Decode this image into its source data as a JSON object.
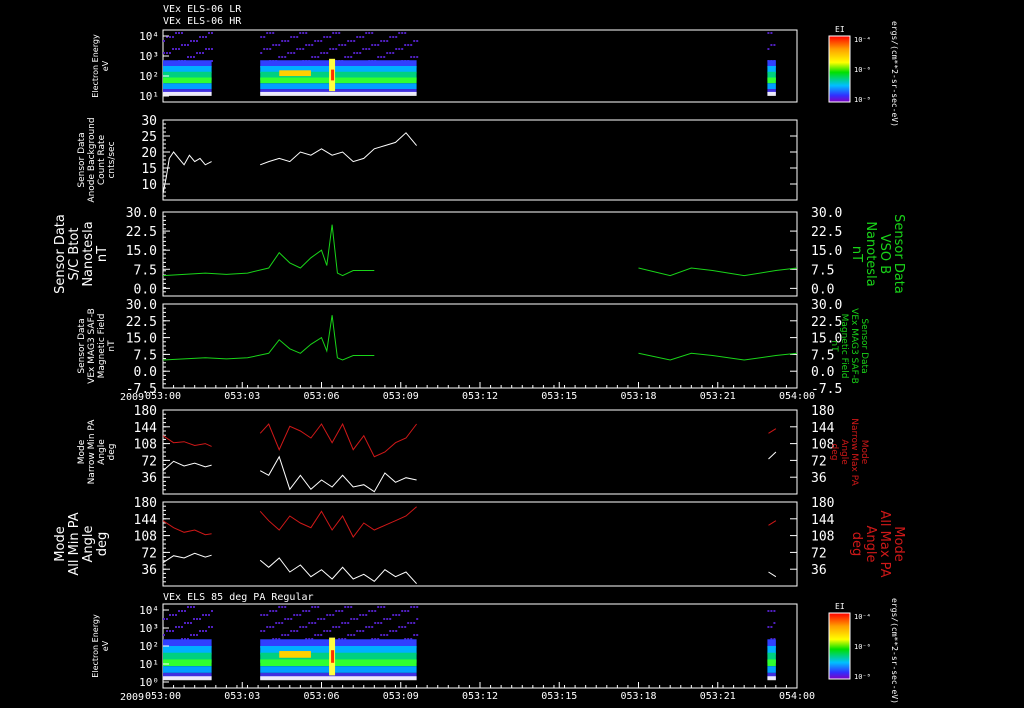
{
  "header_lines": [
    "VEx ELS-06 LR",
    "VEx ELS-06 HR"
  ],
  "year_label": "2009",
  "time_ticks": [
    "053:00",
    "053:03",
    "053:06",
    "053:09",
    "053:12",
    "053:15",
    "053:18",
    "053:21",
    "054:00"
  ],
  "colors": {
    "white": "#ffffff",
    "green": "#19d419",
    "red": "#d01818",
    "background": "#000000"
  },
  "colorbar": {
    "label": "EI",
    "unit": "ergs/(cm**2-sr-sec-eV)",
    "tick_labels": [
      "10⁻⁴",
      "10⁻⁶",
      "10⁻⁸"
    ]
  },
  "chart_data": [
    {
      "type": "heatmap",
      "id": "spectrogram-top",
      "ylabel_lines": [
        "Electron Energy",
        "eV"
      ],
      "y_tick_labels": [
        "10⁴",
        "10³",
        "10²",
        "10¹"
      ],
      "y_scale": "log",
      "x_range": [
        "053:00",
        "054:00"
      ],
      "data_intervals_min": [
        [
          0,
          4.6
        ],
        [
          9.2,
          24.0
        ],
        [
          57.2,
          58.0
        ]
      ],
      "note_peak_near_min": 16
    },
    {
      "type": "line",
      "id": "background-counts",
      "ylabel_lines": [
        "Sensor Data",
        "Anode Background",
        "Count Rate",
        "cnts/sec"
      ],
      "y_tick_labels": [
        "30",
        "25",
        "20",
        "15",
        "10"
      ],
      "ylim": [
        5,
        30
      ],
      "series": [
        {
          "color": "white",
          "x_min": [
            0,
            0.3,
            0.6,
            1,
            1.5,
            2,
            2.5,
            3,
            3.5,
            4,
            4.6,
            9.2,
            10,
            11,
            12,
            13,
            14,
            15,
            16,
            17,
            18,
            19,
            20,
            21,
            22,
            23,
            24
          ],
          "y": [
            7,
            12,
            18,
            20,
            18,
            16,
            19,
            17,
            18,
            16,
            17,
            16,
            17,
            18,
            17,
            20,
            19,
            21,
            19,
            20,
            17,
            18,
            21,
            22,
            23,
            26,
            22
          ]
        }
      ]
    },
    {
      "type": "line",
      "id": "bmag-sc",
      "ylabel_lines": [
        "Sensor Data",
        "S/C Btot",
        "Nanotesla",
        "nT"
      ],
      "right_label_lines": [
        "Sensor Data",
        "VSO B",
        "Nanotesla",
        "nT"
      ],
      "y_tick_labels": [
        "30.0",
        "22.5",
        "15.0",
        "7.5",
        "0.0"
      ],
      "ylim": [
        -3,
        30
      ],
      "series": [
        {
          "color": "green",
          "x_min": [
            0,
            2,
            4,
            6,
            8,
            10,
            11,
            12,
            13,
            14,
            15,
            15.5,
            16,
            16.5,
            17,
            18,
            20,
            25,
            30,
            35,
            40,
            45,
            48,
            50,
            52,
            55,
            58,
            60
          ],
          "y": [
            5,
            5.5,
            6,
            5.5,
            6,
            8,
            14,
            10,
            8,
            12,
            15,
            9,
            25,
            6,
            5,
            7,
            7,
            9,
            10,
            9,
            8,
            8,
            5,
            8,
            7,
            5,
            7,
            8
          ]
        }
      ]
    },
    {
      "type": "line",
      "id": "bmag-saf",
      "ylabel_lines": [
        "Sensor Data",
        "VEx MAG3 SAF-B",
        "Magnetic Field",
        "nT"
      ],
      "right_label_lines": [
        "Sensor Data",
        "VEx MAG3 SAF-B",
        "Magnetic Field",
        "nT"
      ],
      "y_tick_labels": [
        "30.0",
        "22.5",
        "15.0",
        "7.5",
        "0.0",
        "-7.5"
      ],
      "ylim": [
        -7.5,
        30
      ],
      "series": [
        {
          "color": "green",
          "x_min": [
            0,
            2,
            4,
            6,
            8,
            10,
            11,
            12,
            13,
            14,
            15,
            15.5,
            16,
            16.5,
            17,
            18,
            20,
            25,
            30,
            35,
            40,
            45,
            48,
            50,
            52,
            55,
            58,
            60
          ],
          "y": [
            5,
            5.5,
            6,
            5.5,
            6,
            8,
            14,
            10,
            8,
            12,
            15,
            9,
            25,
            6,
            5,
            7,
            7,
            9,
            10,
            9,
            8,
            8,
            5,
            8,
            7,
            5,
            7,
            8
          ]
        }
      ]
    },
    {
      "type": "line",
      "id": "pa-narrow",
      "ylabel_lines": [
        "Mode",
        "Narrow Min PA",
        "Angle",
        "deg"
      ],
      "right_label_lines": [
        "Mode",
        "Narrow Max PA",
        "Angle",
        "deg"
      ],
      "y_tick_labels": [
        "180",
        "144",
        "108",
        "72",
        "36"
      ],
      "ylim": [
        0,
        180
      ],
      "series": [
        {
          "name": "Narrow Max PA",
          "color": "red",
          "x_min": [
            0,
            1,
            2,
            3,
            4,
            4.6,
            9.2,
            10,
            11,
            12,
            13,
            14,
            15,
            16,
            17,
            18,
            19,
            20,
            21,
            22,
            23,
            24,
            57.3,
            58
          ],
          "y": [
            125,
            110,
            112,
            104,
            108,
            102,
            130,
            150,
            95,
            145,
            135,
            120,
            150,
            110,
            150,
            95,
            125,
            80,
            90,
            110,
            120,
            150,
            130,
            140
          ]
        },
        {
          "name": "Narrow Min PA",
          "color": "white",
          "x_min": [
            0,
            1,
            2,
            3,
            4,
            4.6,
            9.2,
            10,
            11,
            12,
            13,
            14,
            15,
            16,
            17,
            18,
            19,
            20,
            21,
            22,
            23,
            24,
            57.3,
            58
          ],
          "y": [
            50,
            70,
            60,
            66,
            58,
            62,
            50,
            40,
            80,
            10,
            40,
            10,
            30,
            15,
            40,
            15,
            20,
            5,
            45,
            25,
            35,
            30,
            75,
            90
          ]
        }
      ]
    },
    {
      "type": "line",
      "id": "pa-all",
      "ylabel_lines": [
        "Mode",
        "All Min PA",
        "Angle",
        "deg"
      ],
      "right_label_lines": [
        "Mode",
        "All Max PA",
        "Angle",
        "deg"
      ],
      "y_tick_labels": [
        "180",
        "144",
        "108",
        "72",
        "36"
      ],
      "ylim": [
        0,
        180
      ],
      "series": [
        {
          "name": "All Max PA",
          "color": "red",
          "x_min": [
            0,
            1,
            2,
            3,
            4,
            4.6,
            9.2,
            10,
            11,
            12,
            13,
            14,
            15,
            16,
            17,
            18,
            19,
            20,
            21,
            22,
            23,
            24,
            57.3,
            58
          ],
          "y": [
            140,
            125,
            115,
            120,
            110,
            112,
            160,
            140,
            120,
            150,
            135,
            125,
            160,
            120,
            150,
            105,
            135,
            120,
            130,
            140,
            150,
            170,
            130,
            140
          ]
        },
        {
          "name": "All Min PA",
          "color": "white",
          "x_min": [
            0,
            1,
            2,
            3,
            4,
            4.6,
            9.2,
            10,
            11,
            12,
            13,
            14,
            15,
            16,
            17,
            18,
            19,
            20,
            21,
            22,
            23,
            24,
            57.3,
            58
          ],
          "y": [
            50,
            65,
            60,
            70,
            62,
            66,
            55,
            40,
            60,
            30,
            45,
            20,
            35,
            15,
            40,
            15,
            25,
            10,
            35,
            20,
            30,
            5,
            30,
            20
          ]
        }
      ]
    },
    {
      "type": "heatmap",
      "id": "spectrogram-bottom",
      "title": "VEx ELS 85 deg PA Regular",
      "ylabel_lines": [
        "Electron Energy",
        "eV"
      ],
      "y_tick_labels": [
        "10⁴",
        "10³",
        "10²",
        "10¹",
        "10⁰"
      ],
      "y_scale": "log",
      "x_range": [
        "053:00",
        "054:00"
      ],
      "data_intervals_min": [
        [
          0,
          4.6
        ],
        [
          9.2,
          24.0
        ],
        [
          57.2,
          58.0
        ]
      ],
      "note_peak_near_min": 16
    }
  ]
}
